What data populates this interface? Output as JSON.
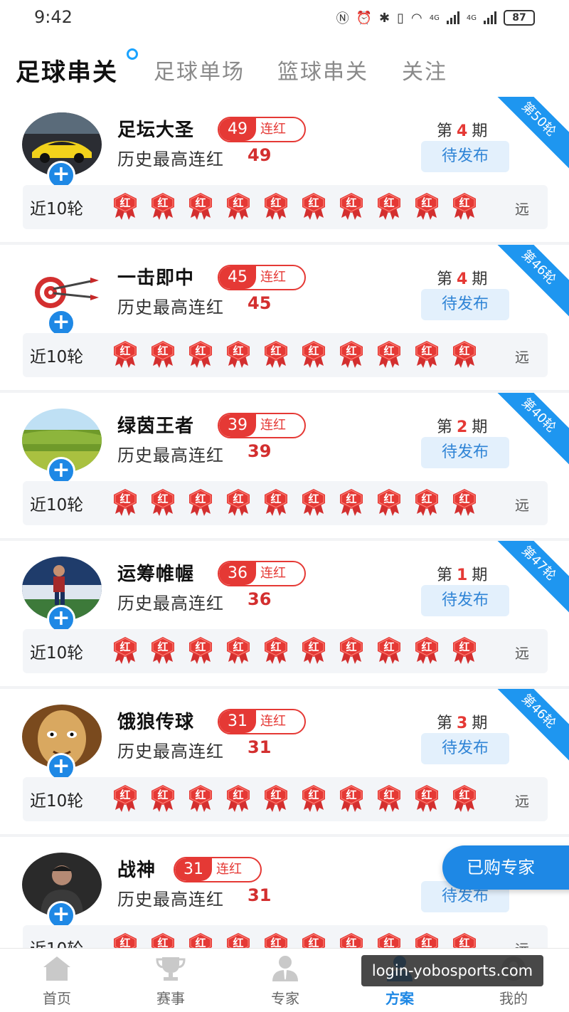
{
  "status_bar": {
    "time": "9:42",
    "battery": "87",
    "network_1": "4G",
    "network_2": "4G"
  },
  "tabs": [
    "足球串关",
    "足球单场",
    "篮球串关",
    "关注"
  ],
  "recent_label": "近10轮",
  "far_label": "远",
  "hist_label": "历史最高连红",
  "streak_suffix": "连红",
  "period_prefix": "第",
  "period_suffix": "期",
  "result_text": "红",
  "experts": [
    {
      "name": "足坛大圣",
      "streak": "49",
      "hist": "49",
      "period": "4",
      "status": "待发布",
      "rounds": "第50轮",
      "avatar": "car",
      "results": [
        "红",
        "红",
        "红",
        "红",
        "红",
        "红",
        "红",
        "红",
        "红",
        "红"
      ]
    },
    {
      "name": "一击即中",
      "streak": "45",
      "hist": "45",
      "period": "4",
      "status": "待发布",
      "rounds": "第46轮",
      "avatar": "target",
      "results": [
        "红",
        "红",
        "红",
        "红",
        "红",
        "红",
        "红",
        "红",
        "红",
        "红"
      ]
    },
    {
      "name": "绿茵王者",
      "streak": "39",
      "hist": "39",
      "period": "2",
      "status": "待发布",
      "rounds": "第40轮",
      "avatar": "field",
      "results": [
        "红",
        "红",
        "红",
        "红",
        "红",
        "红",
        "红",
        "红",
        "红",
        "红"
      ]
    },
    {
      "name": "运筹帷幄",
      "streak": "36",
      "hist": "36",
      "period": "1",
      "status": "待发布",
      "rounds": "第47轮",
      "avatar": "player",
      "results": [
        "红",
        "红",
        "红",
        "红",
        "红",
        "红",
        "红",
        "红",
        "红",
        "红"
      ]
    },
    {
      "name": "饿狼传球",
      "streak": "31",
      "hist": "31",
      "period": "3",
      "status": "待发布",
      "rounds": "第46轮",
      "avatar": "cartoon",
      "results": [
        "红",
        "红",
        "红",
        "红",
        "红",
        "红",
        "红",
        "红",
        "红",
        "红"
      ]
    },
    {
      "name": "战神",
      "streak": "31",
      "hist": "31",
      "period": "",
      "status": "待发布",
      "rounds": "",
      "avatar": "man",
      "results": [
        "红",
        "红",
        "红",
        "红",
        "红",
        "红",
        "红",
        "红",
        "红",
        "红"
      ]
    }
  ],
  "float_button": "已购专家",
  "bottom_nav": [
    {
      "label": "首页",
      "icon": "home-icon"
    },
    {
      "label": "赛事",
      "icon": "trophy-icon"
    },
    {
      "label": "专家",
      "icon": "expert-icon"
    },
    {
      "label": "方案",
      "icon": "plan-icon",
      "active": true
    },
    {
      "label": "我的",
      "icon": "profile-icon"
    }
  ],
  "watermark": "login-yobosports.com",
  "colors": {
    "accent": "#1e88e5",
    "red": "#e53935",
    "ribbon": "#1e96f0"
  }
}
